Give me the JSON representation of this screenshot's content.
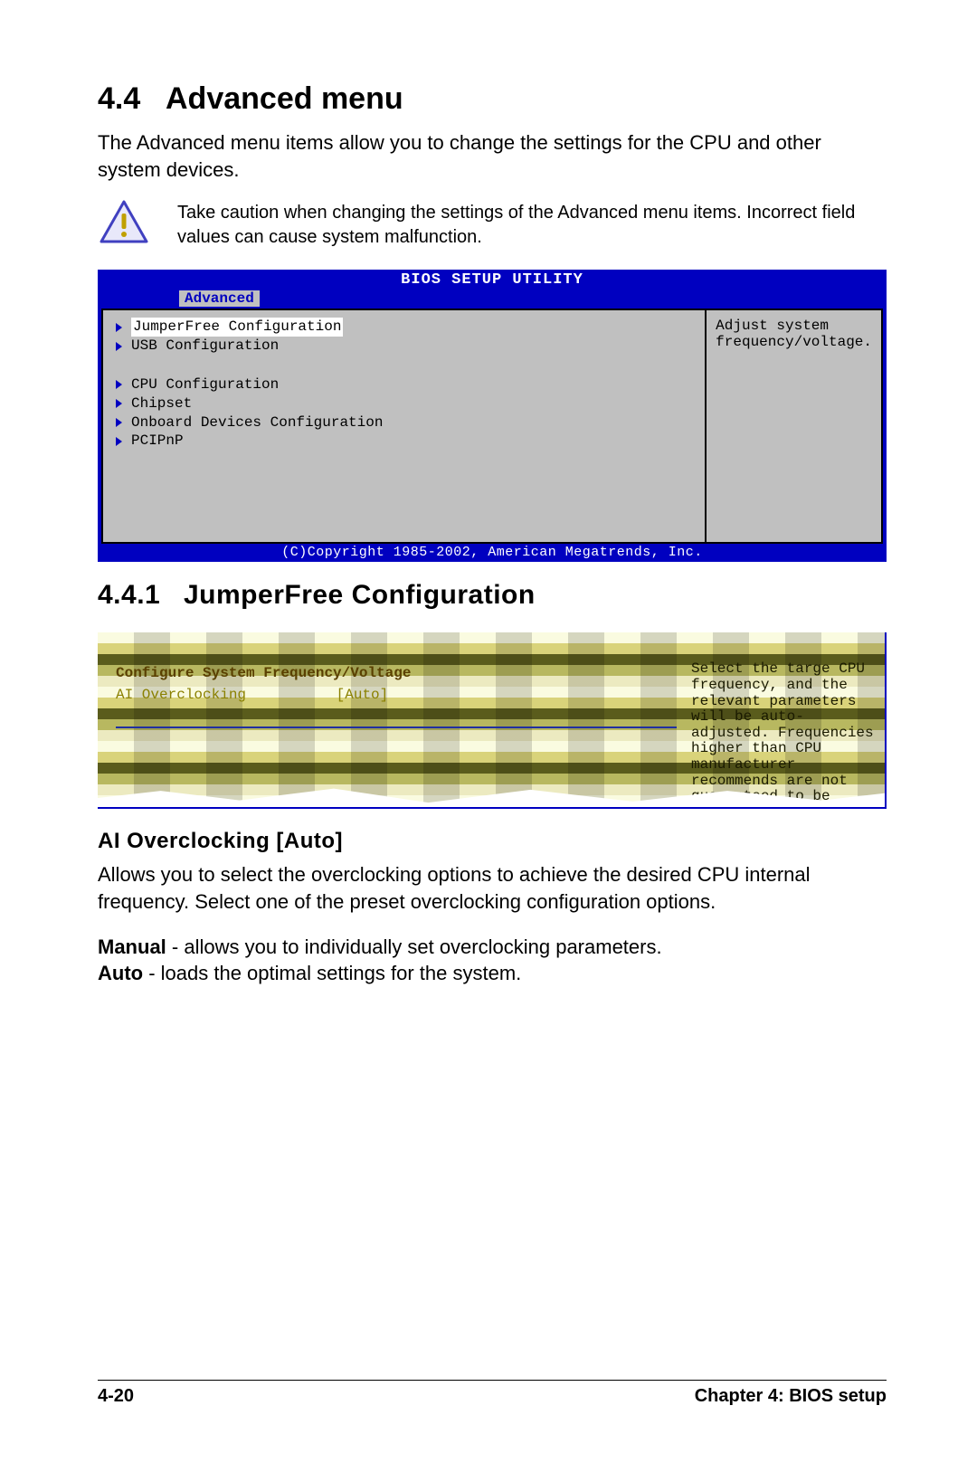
{
  "section": {
    "number": "4.4",
    "title": "Advanced menu"
  },
  "intro": "The Advanced menu items allow you to change the settings for the CPU and other system devices.",
  "caution": "Take caution when changing the settings of the Advanced menu items. Incorrect field values can cause system malfunction.",
  "bios1": {
    "title": "BIOS SETUP UTILITY",
    "tab": "Advanced",
    "items_group1": [
      "JumperFree Configuration",
      "USB Configuration"
    ],
    "items_group2": [
      "CPU Configuration",
      "Chipset",
      "Onboard Devices Configuration",
      "PCIPnP"
    ],
    "help": "Adjust system frequency/voltage.",
    "copyright": "(C)Copyright 1985-2002, American Megatrends, Inc."
  },
  "subsection": {
    "number": "4.4.1",
    "title": "JumperFree Configuration"
  },
  "bios2": {
    "heading": "Configure System Frequency/Voltage",
    "item_label": "AI Overclocking",
    "item_value": "[Auto]",
    "help": "Select the targe CPU frequency, and the relevant parameters will be auto-adjusted. Frequencies higher than CPU manufacturer recommends are not guaranteed to be stable. If the system becomes unstable, return to the default."
  },
  "h3": "AI Overclocking [Auto]",
  "h3_para": "Allows you to select the overclocking options to achieve the desired CPU internal frequency. Select one of the preset overclocking configuration options.",
  "options": {
    "manual_label": "Manual",
    "manual_text": " - allows you to individually set overclocking parameters.",
    "auto_label": "Auto",
    "auto_text": " - loads the optimal settings for the system."
  },
  "footer": {
    "page": "4-20",
    "chapter": "Chapter 4: BIOS setup"
  }
}
